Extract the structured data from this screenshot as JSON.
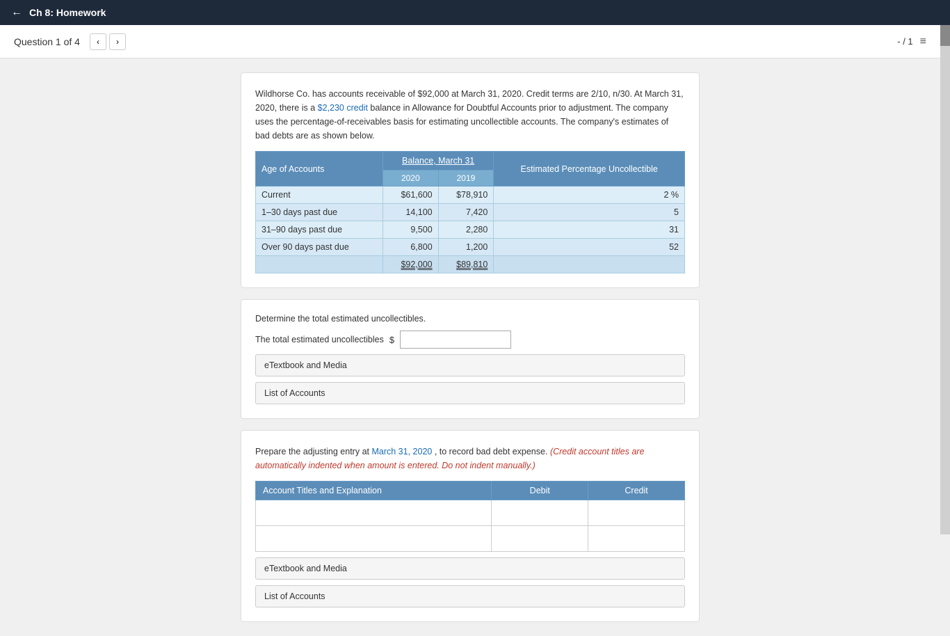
{
  "nav": {
    "back_label": "←",
    "title": "Ch 8: Homework"
  },
  "question_header": {
    "label": "Question 1 of 4",
    "prev_btn": "‹",
    "next_btn": "›",
    "page_indicator": "- / 1",
    "list_icon": "≡"
  },
  "problem": {
    "text_part1": "Wildhorse Co. has accounts receivable of $92,000 at March 31, 2020. Credit terms are 2/10, n/30. At March 31, 2020, there is a",
    "text_highlight1": "$2,230 credit",
    "text_part2": "balance in Allowance for Doubtful Accounts prior to adjustment. The company uses the percentage-of-receivables basis for estimating uncollectible accounts. The company's estimates of bad debts are as shown below.",
    "table": {
      "header_col1": "Age of Accounts",
      "header_balance": "Balance, March 31",
      "header_2020": "2020",
      "header_2019": "2019",
      "header_estimated": "Estimated Percentage Uncollectible",
      "rows": [
        {
          "age": "Current",
          "val2020": "$61,600",
          "val2019": "$78,910",
          "pct": "2 %"
        },
        {
          "age": "1–30 days past due",
          "val2020": "14,100",
          "val2019": "7,420",
          "pct": "5"
        },
        {
          "age": "31–90 days past due",
          "val2020": "9,500",
          "val2019": "2,280",
          "pct": "31"
        },
        {
          "age": "Over 90 days past due",
          "val2020": "6,800",
          "val2019": "1,200",
          "pct": "52"
        }
      ],
      "total_2020": "$92,000",
      "total_2019": "$89,810"
    }
  },
  "section1": {
    "instruction": "Determine the total estimated uncollectibles.",
    "input_label": "The total estimated uncollectibles",
    "dollar_sign": "$",
    "input_placeholder": "",
    "etextbook_btn": "eTextbook and Media",
    "list_accounts_btn": "List of Accounts"
  },
  "section2": {
    "instruction_part1": "Prepare the adjusting entry at",
    "instruction_blue": "March 31, 2020",
    "instruction_part2": ", to record bad debt expense.",
    "instruction_red": "(Credit account titles are automatically indented when amount is entered. Do not indent manually.)",
    "table_headers": {
      "account": "Account Titles and Explanation",
      "debit": "Debit",
      "credit": "Credit"
    },
    "rows": [
      {
        "account": "",
        "debit": "",
        "credit": ""
      },
      {
        "account": "",
        "debit": "",
        "credit": ""
      }
    ],
    "etextbook_btn": "eTextbook and Media",
    "list_accounts_btn": "List of Accounts"
  }
}
